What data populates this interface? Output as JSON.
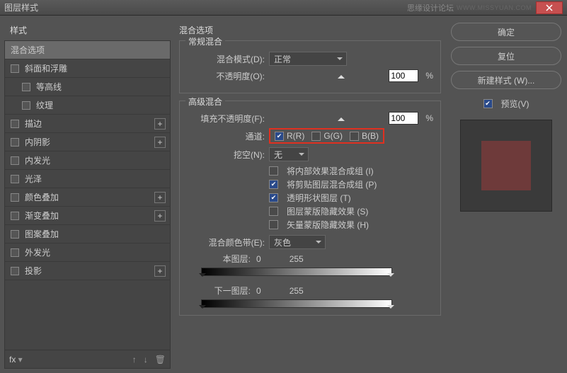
{
  "titlebar": {
    "title": "图层样式",
    "watermark": "思缘设计论坛",
    "watermark2": "WWW.MISSYUAN.COM"
  },
  "sidebar": {
    "header": "样式",
    "items": [
      {
        "label": "混合选项",
        "selected": true,
        "checkbox": false
      },
      {
        "label": "斜面和浮雕",
        "cb": false
      },
      {
        "label": "等高线",
        "cb": false,
        "indent": true
      },
      {
        "label": "纹理",
        "cb": false,
        "indent": true
      },
      {
        "label": "描边",
        "cb": false,
        "plus": true
      },
      {
        "label": "内阴影",
        "cb": false,
        "plus": true
      },
      {
        "label": "内发光",
        "cb": false
      },
      {
        "label": "光泽",
        "cb": false
      },
      {
        "label": "颜色叠加",
        "cb": false,
        "plus": true
      },
      {
        "label": "渐变叠加",
        "cb": false,
        "plus": true
      },
      {
        "label": "图案叠加",
        "cb": false
      },
      {
        "label": "外发光",
        "cb": false
      },
      {
        "label": "投影",
        "cb": false,
        "plus": true
      }
    ],
    "footer_fx": "fx"
  },
  "center": {
    "blend_options": "混合选项",
    "general": {
      "legend": "常规混合",
      "mode_label": "混合模式(D):",
      "mode_value": "正常",
      "opacity_label": "不透明度(O):",
      "opacity_value": "100",
      "pct": "%"
    },
    "advanced": {
      "legend": "高级混合",
      "fill_label": "填充不透明度(F):",
      "fill_value": "100",
      "pct": "%",
      "channels_label": "通道:",
      "r": "R(R)",
      "g": "G(G)",
      "b": "B(B)",
      "r_chk": true,
      "g_chk": false,
      "b_chk": false,
      "knockout_label": "挖空(N):",
      "knockout_value": "无",
      "opts": [
        {
          "label": "将内部效果混合成组 (I)",
          "chk": false
        },
        {
          "label": "将剪贴图层混合成组 (P)",
          "chk": true
        },
        {
          "label": "透明形状图层 (T)",
          "chk": true
        },
        {
          "label": "图层蒙版隐藏效果 (S)",
          "chk": false
        },
        {
          "label": "矢量蒙版隐藏效果 (H)",
          "chk": false
        }
      ],
      "blendif_label": "混合颜色带(E):",
      "blendif_value": "灰色",
      "this_layer": "本图层:",
      "this_v0": "0",
      "this_v1": "255",
      "under_layer": "下一图层:",
      "under_v0": "0",
      "under_v1": "255"
    }
  },
  "right": {
    "ok": "确定",
    "cancel": "复位",
    "new_style": "新建样式 (W)...",
    "preview": "预览(V)",
    "preview_chk": true
  }
}
